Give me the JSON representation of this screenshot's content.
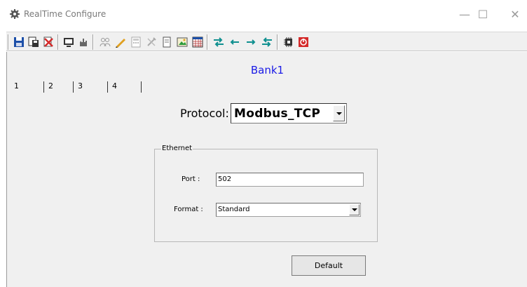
{
  "window": {
    "title": "RealTime Configure",
    "minimize_glyph": "—",
    "maximize_glyph": "☐",
    "close_glyph": "✕"
  },
  "toolbar": {
    "groups": [
      [
        "save-icon",
        "save-as-icon",
        "delete-icon"
      ],
      [
        "monitor-icon",
        "hand-icon"
      ],
      [
        "group-icon",
        "pencil-icon",
        "calculator-icon",
        "wrench-icon",
        "page-icon",
        "image-icon",
        "grid-icon"
      ],
      [
        "arrows-both-icon",
        "arrow-left-icon",
        "arrow-right-icon",
        "arrows-both-icon"
      ],
      [
        "chip-icon",
        "power-icon"
      ]
    ]
  },
  "bank_title": "Bank1",
  "tabs": [
    "1",
    "2",
    "3",
    "4"
  ],
  "protocol": {
    "label": "Protocol:",
    "value": "Modbus_TCP"
  },
  "ethernet": {
    "group_title": "Ethernet",
    "port_label": "Port :",
    "port_value": "502",
    "format_label": "Format :",
    "format_value": "Standard"
  },
  "default_button": "Default",
  "colors": {
    "bank_title": "#1a1ae6",
    "panel_bg": "#f0f0f0",
    "toolbar_blue": "#1c4fa8",
    "toolbar_red": "#d42a2a",
    "toolbar_teal": "#109090"
  }
}
